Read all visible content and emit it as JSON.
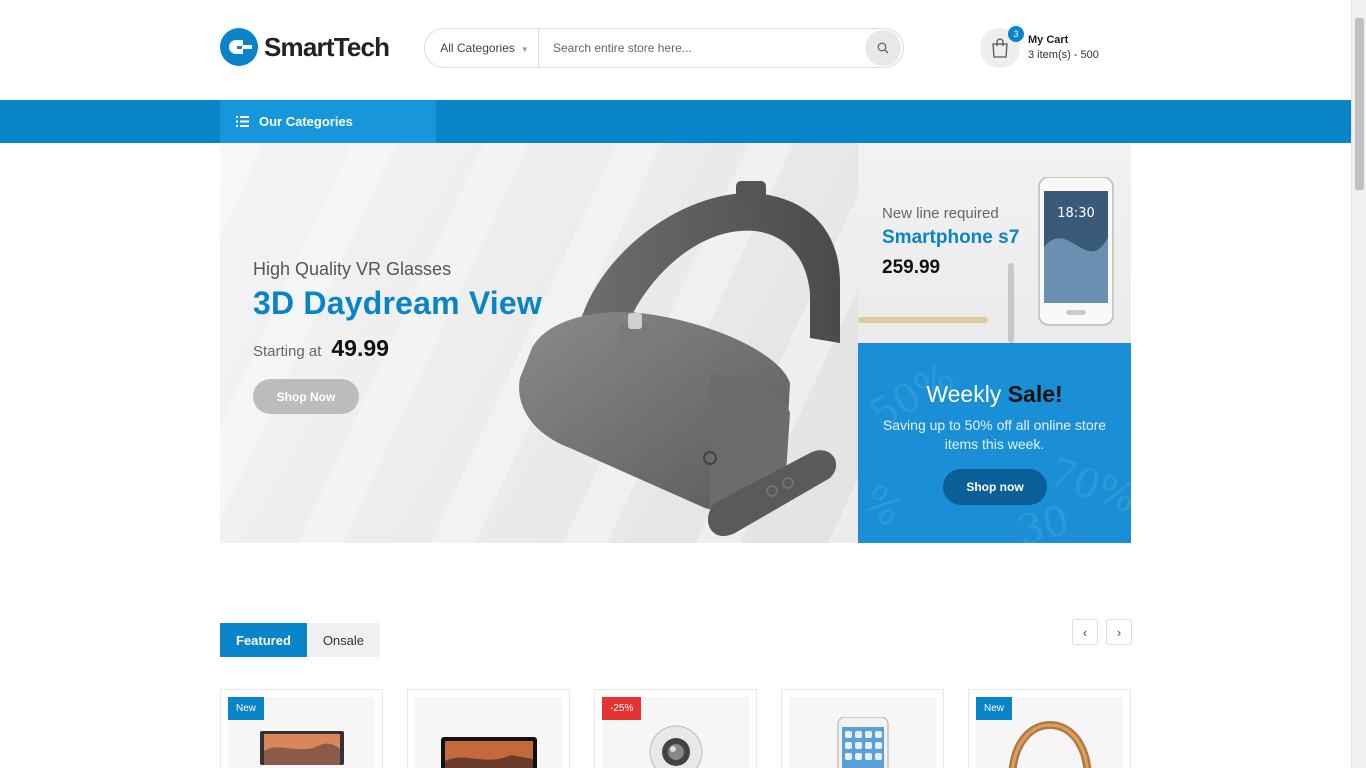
{
  "header": {
    "brand": "SmartTech",
    "search": {
      "category": "All Categories",
      "placeholder": "Search entire store here..."
    },
    "cart": {
      "badge": "3",
      "title": "My Cart",
      "summary": "3 item(s) - 500"
    }
  },
  "nav": {
    "categories_label": "Our Categories"
  },
  "hero": {
    "subtitle": "High Quality VR Glasses",
    "title": "3D Daydream View",
    "price_prefix": "Starting at",
    "price": "49.99",
    "button": "Shop Now"
  },
  "promo_phone": {
    "line1": "New line required",
    "line2": "Smartphone s7",
    "price": "259.99"
  },
  "promo_sale": {
    "title_light": "Weekly",
    "title_bold": "Sale!",
    "description": "Saving up to 50% off all online store items this week.",
    "button": "Shop now"
  },
  "products_section": {
    "tabs": [
      {
        "label": "Featured",
        "active": true
      },
      {
        "label": "Onsale",
        "active": false
      }
    ],
    "prev_icon": "chevron-left-icon",
    "next_icon": "chevron-right-icon"
  },
  "products": [
    {
      "badge": "New",
      "badge_type": "new",
      "icon": "laptop"
    },
    {
      "badge": "",
      "badge_type": "",
      "icon": "tablet"
    },
    {
      "badge": "-25%",
      "badge_type": "sale",
      "icon": "camera-360"
    },
    {
      "badge": "",
      "badge_type": "",
      "icon": "smartphone"
    },
    {
      "badge": "New",
      "badge_type": "new",
      "icon": "headphones"
    }
  ],
  "colors": {
    "accent": "#0a84c9",
    "sale": "#e53333",
    "nav_highlight": "#1896dc"
  }
}
